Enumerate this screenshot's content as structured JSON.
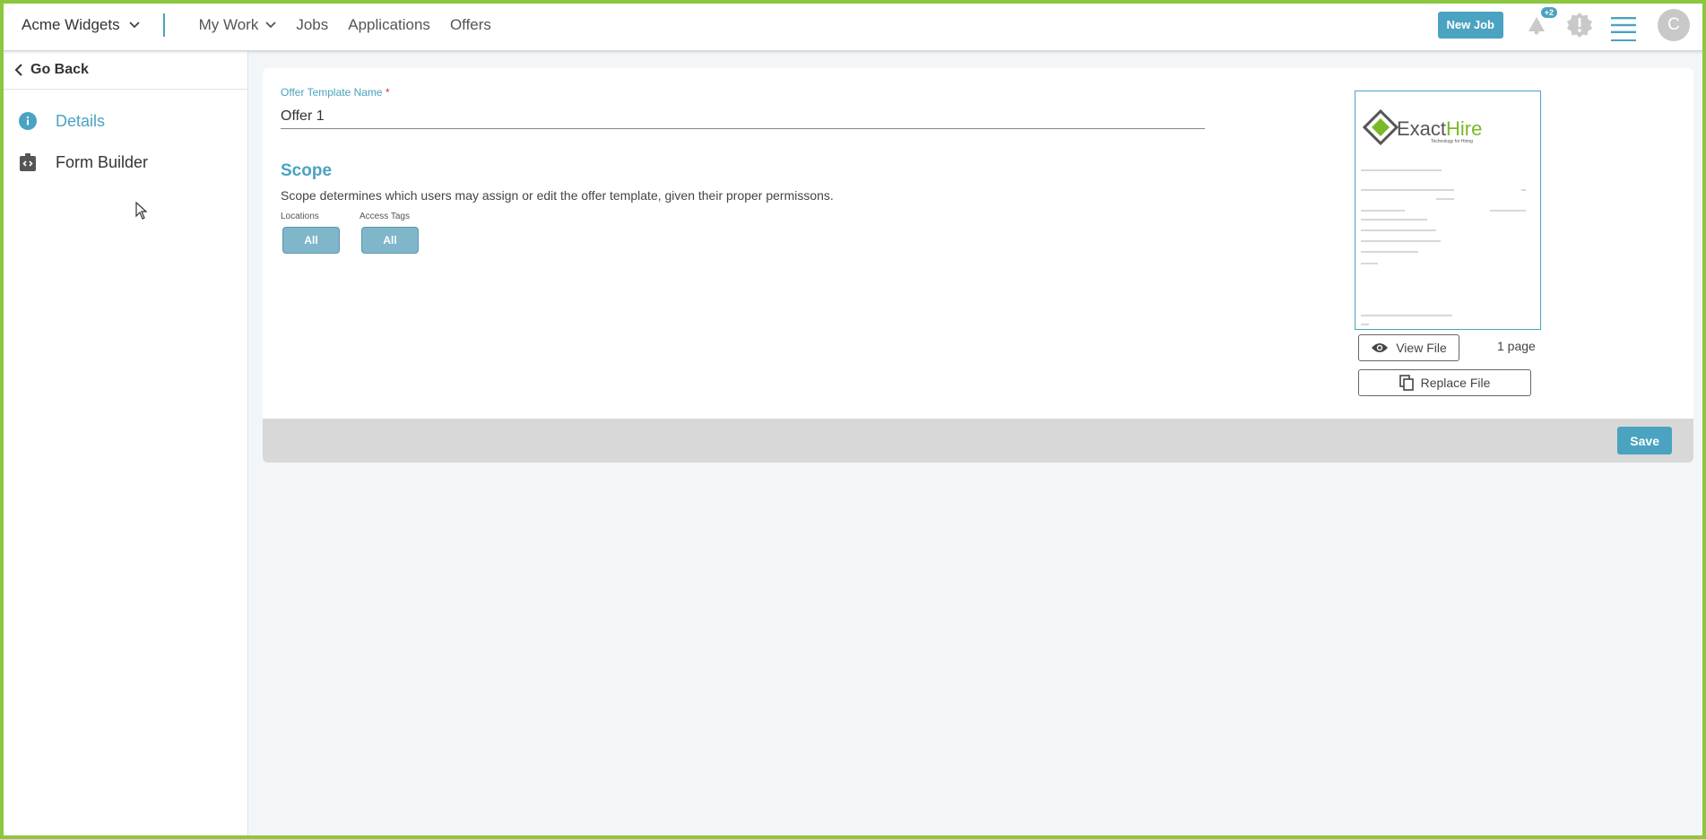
{
  "header": {
    "org_name": "Acme Widgets",
    "nav": [
      "My Work",
      "Jobs",
      "Applications",
      "Offers"
    ],
    "new_job_label": "New Job",
    "notification_badge": "+2",
    "avatar_initial": "C"
  },
  "sidebar": {
    "go_back": "Go Back",
    "items": [
      {
        "label": "Details",
        "icon": "info-icon",
        "active": true
      },
      {
        "label": "Form Builder",
        "icon": "form-builder-icon",
        "active": false
      }
    ]
  },
  "form": {
    "name_label": "Offer Template Name",
    "required_mark": "*",
    "name_value": "Offer 1",
    "scope_title": "Scope",
    "scope_description": "Scope determines which users may assign or edit the offer template, given their proper permissons.",
    "locations_label": "Locations",
    "locations_value": "All",
    "access_tags_label": "Access Tags",
    "access_tags_value": "All"
  },
  "file": {
    "logo_text_a": "Exact",
    "logo_text_b": "Hire",
    "logo_tagline": "Technology for Hiring",
    "view_label": "View File",
    "replace_label": "Replace File",
    "page_count": "1 page"
  },
  "actions": {
    "save_label": "Save"
  },
  "colors": {
    "accent": "#4aa3c0",
    "frame": "#8dc63f",
    "logo_green": "#7ab929"
  }
}
